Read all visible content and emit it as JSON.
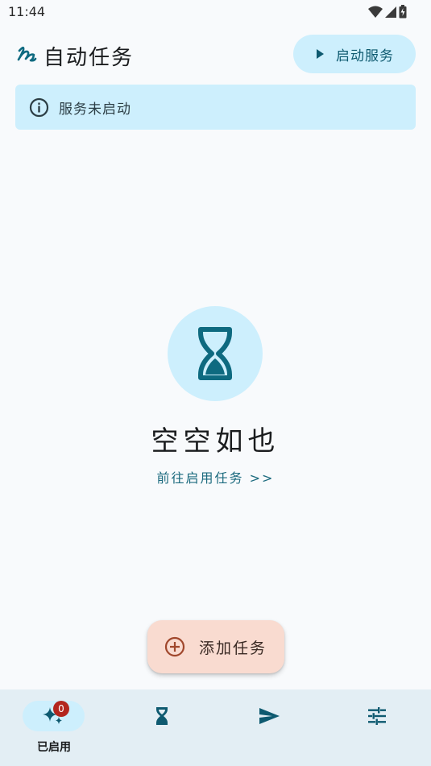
{
  "status_bar": {
    "time": "11:44",
    "icons": [
      "wifi-icon",
      "signal-icon",
      "battery-icon"
    ]
  },
  "app_bar": {
    "title": "自动任务",
    "logo_icon": "squiggle-logo-icon",
    "start_button_label": "启动服务",
    "start_button_icon": "play-icon"
  },
  "info_banner": {
    "icon": "info-icon",
    "text": "服务未启动"
  },
  "empty_state": {
    "icon": "hourglass-icon",
    "title": "空空如也",
    "link_text": "前往启用任务 >>"
  },
  "fab": {
    "icon": "add-circle-icon",
    "label": "添加任务"
  },
  "bottom_nav": {
    "items": [
      {
        "icon": "sparkles-icon",
        "label": "已启用",
        "badge": "0",
        "selected": true
      },
      {
        "icon": "hourglass-icon",
        "label": "",
        "selected": false
      },
      {
        "icon": "send-icon",
        "label": "",
        "selected": false
      },
      {
        "icon": "tune-icon",
        "label": "",
        "selected": false
      }
    ]
  },
  "colors": {
    "background": "#f8fafc",
    "accent": "#0e6a80",
    "accent_container": "#cdeffd",
    "fab_container": "#f9dbd0",
    "fab_icon": "#a0472c",
    "badge": "#b3261e",
    "nav_background": "#e3eef4"
  }
}
